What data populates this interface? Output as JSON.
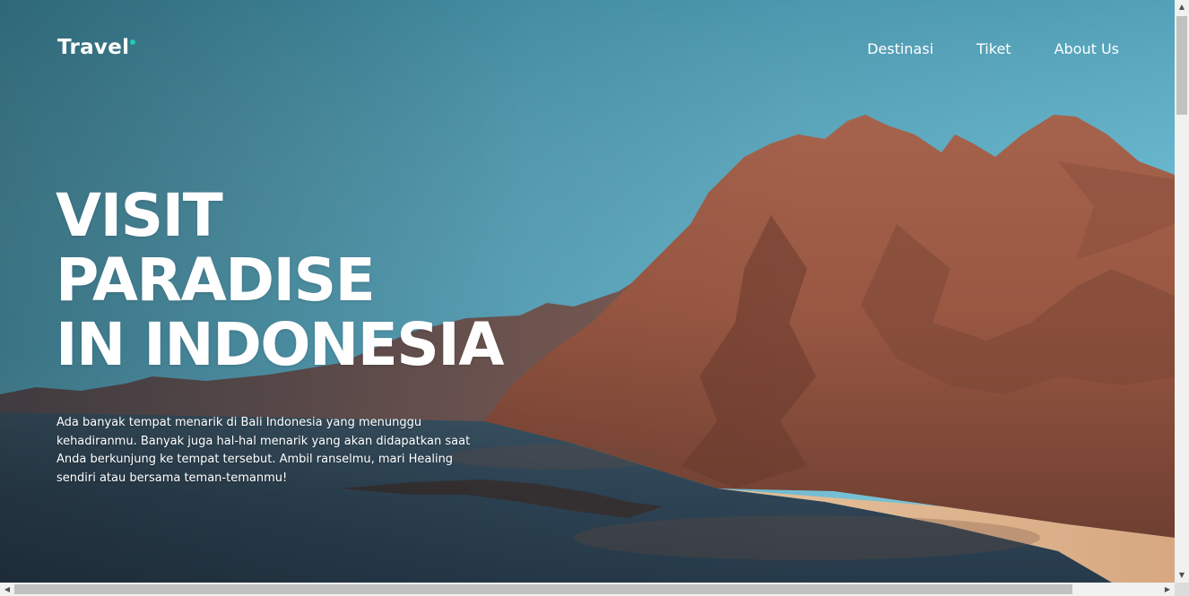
{
  "brand": {
    "logo_text": "Travel",
    "accent_color": "#27c8b8"
  },
  "nav": {
    "items": [
      {
        "label": "Destinasi"
      },
      {
        "label": "Tiket"
      },
      {
        "label": "About Us"
      }
    ]
  },
  "hero": {
    "headline_lines": [
      "VISIT",
      "PARADISE",
      "IN INDONESIA"
    ],
    "description": "Ada banyak tempat menarik di Bali Indonesia yang menunggu kehadiranmu. Banyak juga hal-hal menarik yang akan didapatkan saat Anda berkunjung ke tempat tersebut. Ambil ranselmu, mari Healing sendiri atau bersama teman-temanmu!",
    "background": "landscape photo: red-brown mountains beside a bay and beach under a blue sky"
  },
  "scrollbars": {
    "vertical_up_icon": "arrow-up-icon",
    "vertical_down_icon": "arrow-down-icon",
    "horizontal_left_icon": "arrow-left-icon",
    "horizontal_right_icon": "arrow-right-icon"
  }
}
